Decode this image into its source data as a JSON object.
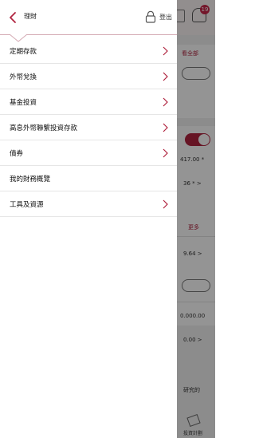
{
  "drawer": {
    "title": "理財",
    "logout_label": "登出",
    "accent_color": "#b0233f",
    "items": [
      {
        "label": "定期存款",
        "has_chevron": true
      },
      {
        "label": "外幣兌換",
        "has_chevron": true
      },
      {
        "label": "基金投資",
        "has_chevron": true
      },
      {
        "label": "高息外幣聯繫投資存款",
        "has_chevron": true
      },
      {
        "label": "債券",
        "has_chevron": true
      },
      {
        "label": "我的財務概覽",
        "has_chevron": false
      },
      {
        "label": "工具及資源",
        "has_chevron": true
      }
    ]
  },
  "background": {
    "notification_count": "19",
    "snippets": {
      "view_all": "看全部",
      "amount_1": "417.00 *",
      "amount_2": "36 * >",
      "more": "更多",
      "amount_3": "9.64 >",
      "amount_4": "0.000.00",
      "amount_5": "0.00 >",
      "research": "研究的",
      "bottom_tab": "投資計劃"
    }
  }
}
